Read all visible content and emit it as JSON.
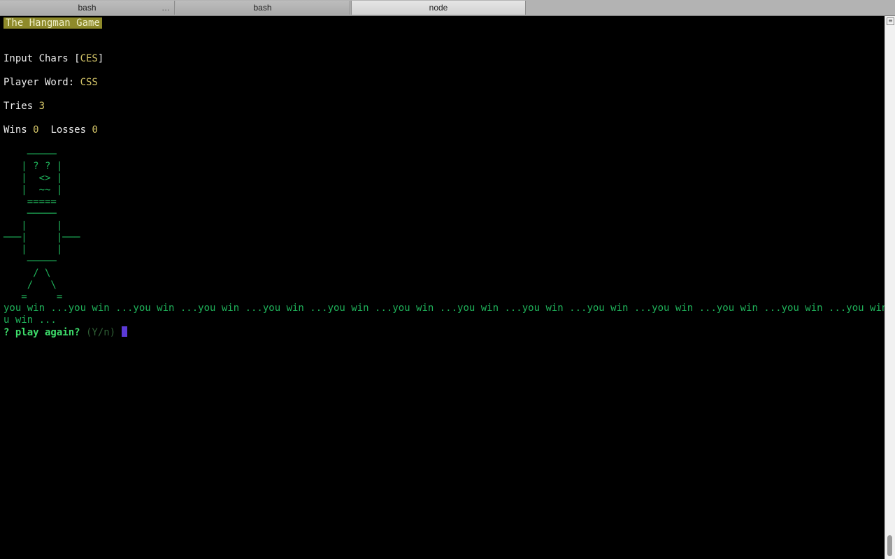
{
  "tabs": [
    {
      "label": "bash",
      "more": "…"
    },
    {
      "label": "bash"
    },
    {
      "label": "node"
    }
  ],
  "terminal": {
    "title": "The Hangman Game",
    "input_chars_label": "Input Chars [",
    "input_chars_value": "CES",
    "input_chars_close": "]",
    "player_word_label": "Player Word: ",
    "player_word_value": "CSS",
    "tries_label": "Tries ",
    "tries_value": "3",
    "wins_label": "Wins ",
    "wins_value": "0",
    "losses_label": "  Losses ",
    "losses_value": "0",
    "ascii_art": "    ─────\n   | ? ? |\n   |  <> |\n   |  ~~ |\n    =====\n    ─────\n   |     |\n───|     |───\n   |     |\n    ─────\n     / \\\n    /   \\\n   =     =",
    "win_line_1": "you win ...you win ...you win ...you win ...you win ...you win ...you win ...you win ...you win ...you win ...you win ...you win ...you win ...you win ...yo",
    "win_line_2": "u win ...",
    "prompt_q": "? ",
    "prompt_text": "play again?",
    "prompt_hint": " (Y/n) "
  },
  "colors": {
    "accent_green": "#1fb25a",
    "highlight_yellow": "#d7c86a",
    "cursor": "#5b3ad6"
  }
}
